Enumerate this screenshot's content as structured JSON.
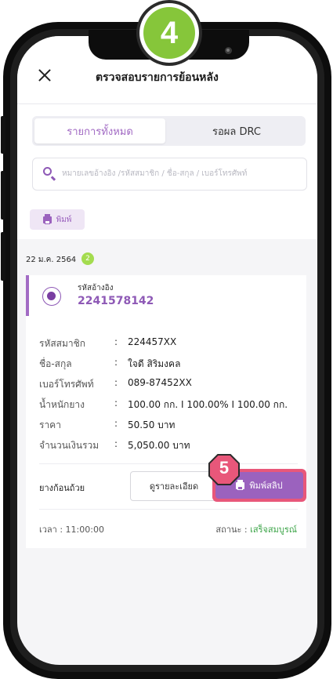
{
  "step_markers": {
    "top": "4",
    "slip": "5"
  },
  "header": {
    "title": "ตรวจสอบรายการย้อนหลัง"
  },
  "tabs": [
    {
      "label": "รายการทั้งหมด",
      "active": true
    },
    {
      "label": "รอผล DRC",
      "active": false
    }
  ],
  "search": {
    "placeholder": "หมายเลขอ้างอิง /รหัสสมาชิก / ชื่อ-สกุล / เบอร์โทรศัพท์"
  },
  "toolbar": {
    "print_label": "พิมพ์"
  },
  "group": {
    "date": "22 ม.ค. 2564",
    "count": "2"
  },
  "record": {
    "ref_label": "รหัสอ้างอิง",
    "ref_value": "2241578142",
    "details": [
      {
        "label": "รหัสสมาชิก",
        "value": "224457XX"
      },
      {
        "label": "ชื่อ-สกุล",
        "value": "ใจดี สิริมงคล"
      },
      {
        "label": "เบอร์โทรศัพท์",
        "value": "089-87452XX"
      },
      {
        "label": "น้ำหนักยาง",
        "value": "100.00 กก. I 100.00% I 100.00 กก."
      },
      {
        "label": "ราคา",
        "value": "50.50 บาท"
      },
      {
        "label": "จำนวนเงินรวม",
        "value": "5,050.00 บาท"
      }
    ],
    "product": "ยางก้อนถ้วย",
    "detail_button": "ดูรายละเอียด",
    "print_slip_button": "พิมพ์สลิป",
    "time": "เวลา : 11:00:00",
    "status_label": "สถานะ :",
    "status_value": "เสร็จสมบูรณ์"
  },
  "colors": {
    "accent": "#9b62be",
    "marker_green": "#86c63a",
    "highlight": "#e8577a",
    "success": "#3ba447"
  }
}
